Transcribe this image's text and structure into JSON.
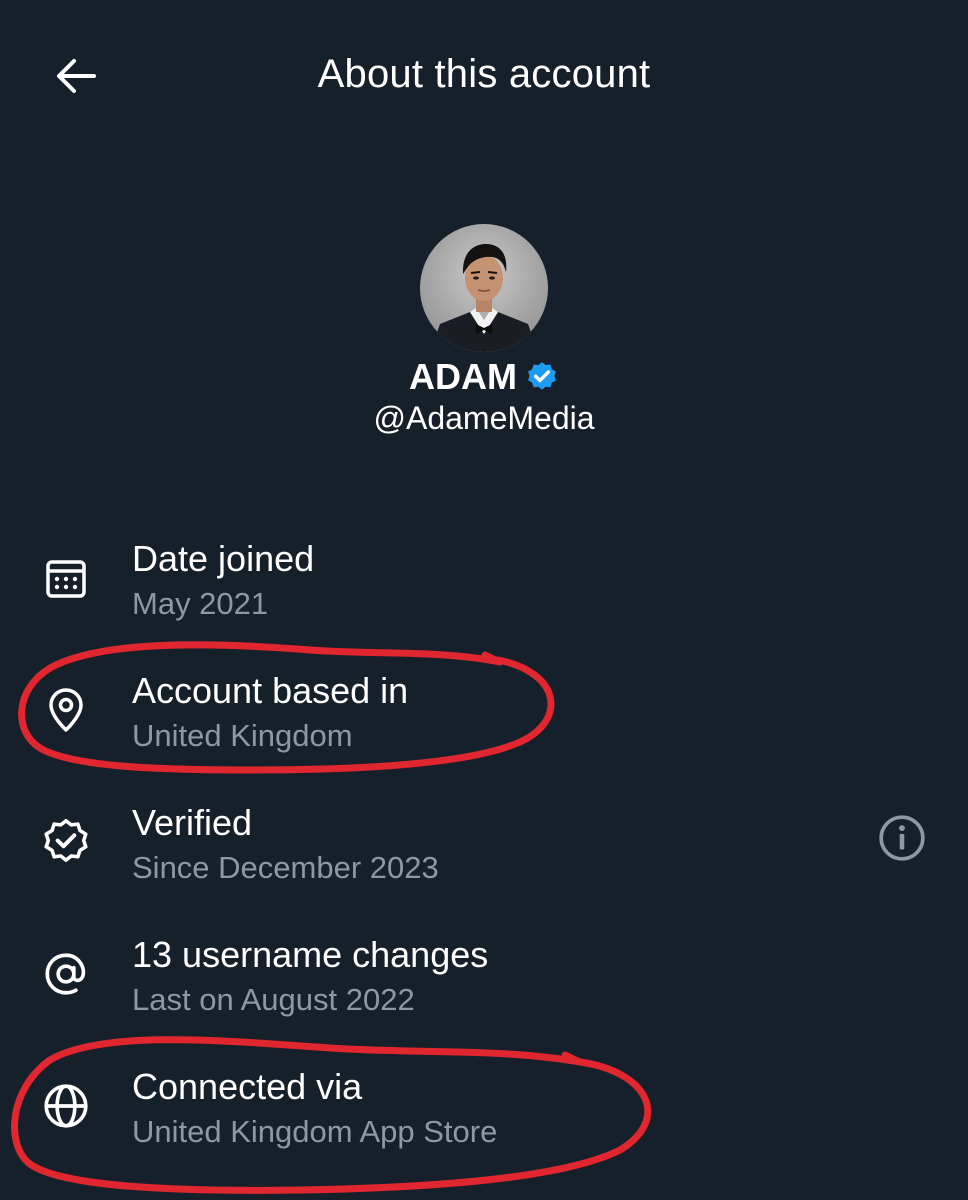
{
  "header": {
    "title": "About this account",
    "back_icon": "arrow-left-icon"
  },
  "profile": {
    "display_name": "ADAM",
    "handle": "@AdameMedia",
    "verified_badge_color": "#1d9bf0",
    "verified_icon": "verified-badge-icon"
  },
  "rows": [
    {
      "icon": "calendar-icon",
      "title": "Date joined",
      "subtitle": "May 2021"
    },
    {
      "icon": "location-pin-icon",
      "title": "Account based in",
      "subtitle": "United Kingdom"
    },
    {
      "icon": "verified-check-icon",
      "title": "Verified",
      "subtitle": "Since December 2023",
      "trailing_icon": "info-icon"
    },
    {
      "icon": "at-sign-icon",
      "title": "13 username changes",
      "subtitle": "Last on August 2022"
    },
    {
      "icon": "globe-icon",
      "title": "Connected via",
      "subtitle": "United Kingdom App Store"
    }
  ],
  "colors": {
    "background": "#16202b",
    "primary_text": "#ffffff",
    "secondary_text": "#8b98a5",
    "annotation": "#e0262e"
  }
}
